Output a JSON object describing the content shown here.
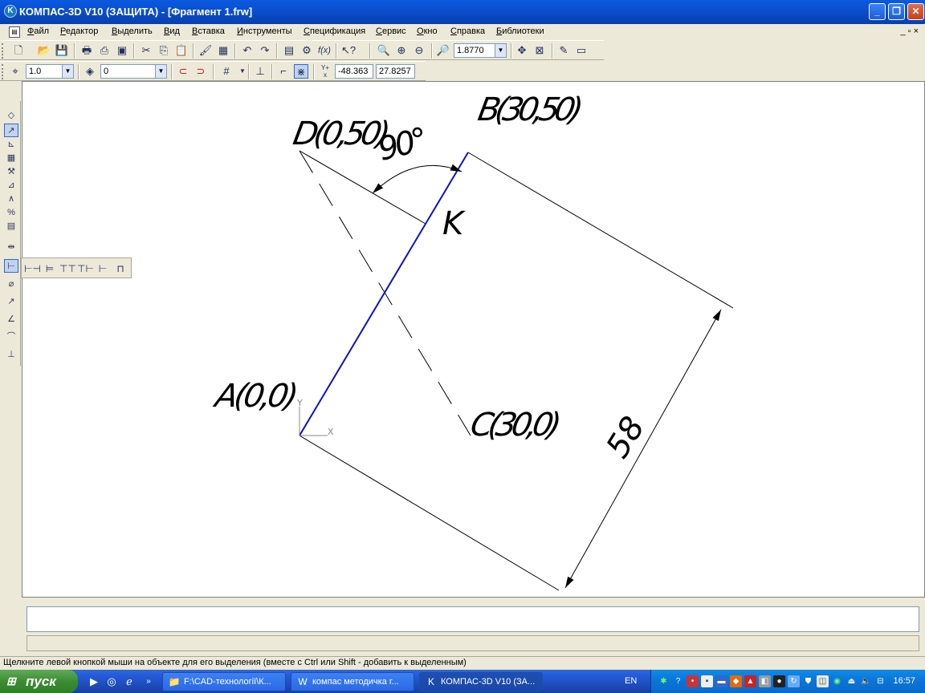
{
  "window": {
    "title": "КОМПАС-3D V10 (ЗАЩИТА) - [Фрагмент 1.frw]",
    "minimize": "_",
    "maximize": "❐",
    "close": "✕",
    "doc_controls": "_ ▫ ×"
  },
  "menu": [
    "Файл",
    "Редактор",
    "Выделить",
    "Вид",
    "Вставка",
    "Инструменты",
    "Спецификация",
    "Сервис",
    "Окно",
    "Справка",
    "Библиотеки"
  ],
  "toolbar_std": {
    "zoom_value": "1.8770"
  },
  "toolbar_props": {
    "step_value": "1.0",
    "layer_value": "0",
    "coord_x": "-48.363",
    "coord_y": "27.8257"
  },
  "drawing": {
    "label_D": "D(0,50)",
    "label_B": "B(30,50)",
    "label_angle": "90°",
    "label_K": "K",
    "label_A": "A(0,0)",
    "label_C": "C(30,0)",
    "label_dim": "58",
    "axis_y": "Y",
    "axis_x": "X"
  },
  "status_text": "Щелкните левой кнопкой мыши на объекте для его выделения (вместе с Ctrl или Shift - добавить к выделенным)",
  "taskbar": {
    "start_label": "пуск",
    "tasks": [
      "F:\\CAD-технології\\К...",
      "компас методичка г...",
      "КОМПАС-3D V10 (ЗА..."
    ],
    "lang": "EN",
    "clock": "16:57"
  },
  "colors": {
    "titlebar": "#0b4fd0",
    "selected_line": "#1010c8",
    "taskbar": "#245edb"
  }
}
